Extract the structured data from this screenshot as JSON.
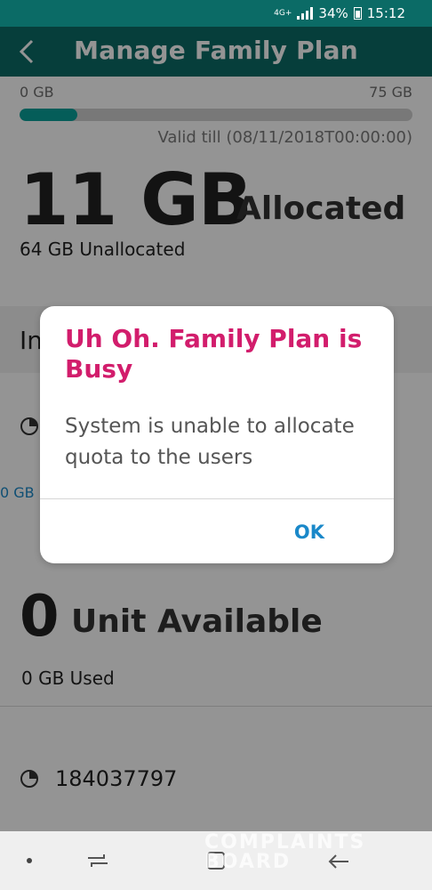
{
  "status_bar": {
    "network": "4G+",
    "battery": "34%",
    "time": "15:12"
  },
  "header": {
    "title": "Manage Family Plan"
  },
  "usage": {
    "min_label": "0 GB",
    "max_label": "75 GB",
    "fill_fraction": 0.147,
    "valid_till": "Valid till (08/11/2018T00:00:00)",
    "allocated_value": "11 GB",
    "allocated_label": "Allocated",
    "unallocated": "64 GB Unallocated"
  },
  "section": {
    "heading_partial": "In",
    "gb_partial": "0 GB"
  },
  "unit": {
    "value": "0",
    "label": "Unit Available",
    "used": "0 GB Used"
  },
  "member": {
    "number": "184037797"
  },
  "dialog": {
    "title": "Uh Oh. Family Plan is Busy",
    "message": "System is unable to allocate quota to the users",
    "ok_label": "OK"
  },
  "watermark": {
    "line1": "COMPLAINTS",
    "line2": "BOARD"
  },
  "colors": {
    "header": "#0b6b66",
    "accent_teal": "#0aa19a",
    "dialog_title": "#d21d6c",
    "link_blue": "#1a88c9"
  }
}
